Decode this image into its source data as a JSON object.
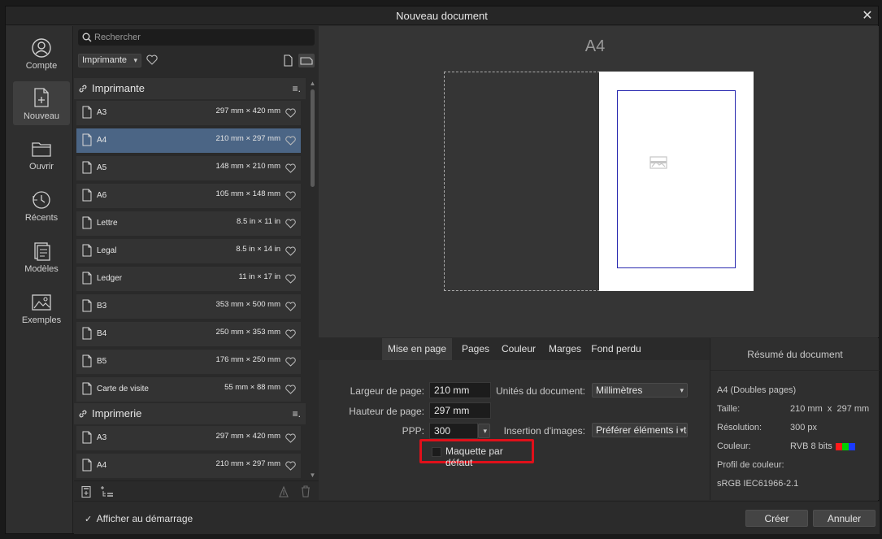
{
  "window": {
    "title": "Nouveau document",
    "close_glyph": "✕"
  },
  "nav": [
    {
      "label": "Compte",
      "icon": "account-icon"
    },
    {
      "label": "Nouveau",
      "icon": "new-document-icon",
      "active": true
    },
    {
      "label": "Ouvrir",
      "icon": "folder-icon"
    },
    {
      "label": "Récents",
      "icon": "recent-clock-icon"
    },
    {
      "label": "Modèles",
      "icon": "templates-icon"
    },
    {
      "label": "Exemples",
      "icon": "samples-image-icon"
    }
  ],
  "list": {
    "search_placeholder": "Rechercher",
    "filter_value": "Imprimante",
    "groups": [
      {
        "title": "Imprimante",
        "menu_glyph": "≡."
      },
      {
        "title": "Imprimerie",
        "menu_glyph": "≡."
      }
    ],
    "printer_rows": [
      {
        "name": "A3",
        "size": "297 mm × 420 mm"
      },
      {
        "name": "A4",
        "size": "210 mm × 297 mm",
        "selected": true
      },
      {
        "name": "A5",
        "size": "148 mm × 210 mm"
      },
      {
        "name": "A6",
        "size": "105 mm × 148 mm"
      },
      {
        "name": "Lettre",
        "size": "8.5 in × 11 in"
      },
      {
        "name": "Legal",
        "size": "8.5 in × 14 in"
      },
      {
        "name": "Ledger",
        "size": "11 in × 17 in"
      },
      {
        "name": "B3",
        "size": "353 mm × 500 mm"
      },
      {
        "name": "B4",
        "size": "250 mm × 353 mm"
      },
      {
        "name": "B5",
        "size": "176 mm × 250 mm"
      },
      {
        "name": "Carte de visite",
        "size": "55 mm × 88 mm"
      }
    ],
    "press_rows": [
      {
        "name": "A3",
        "size": "297 mm × 420 mm"
      },
      {
        "name": "A4",
        "size": "210 mm × 297 mm"
      }
    ]
  },
  "preview": {
    "title": "A4"
  },
  "tabs": [
    "Mise en page",
    "Pages",
    "Couleur",
    "Marges",
    "Fond perdu"
  ],
  "layout_form": {
    "width_label": "Largeur de page:",
    "width_value": "210 mm",
    "height_label": "Hauteur de page:",
    "height_value": "297 mm",
    "dpi_label": "PPP:",
    "dpi_value": "300",
    "units_label": "Unités du document:",
    "units_value": "Millimètres",
    "images_label": "Insertion d'images:",
    "images_value": "Préférer éléments intégrés",
    "default_master_label": "Maquette par défaut",
    "default_master_checked": false
  },
  "summary": {
    "title": "Résumé du document",
    "doc_type": "A4 (Doubles pages)",
    "size_label": "Taille:",
    "size_value": "210 mm  x  297 mm",
    "resolution_label": "Résolution:",
    "resolution_value": "300 px",
    "color_label": "Couleur:",
    "color_value": "RVB 8 bits",
    "swatches": [
      "#ff1a1a",
      "#00d000",
      "#1a3aff"
    ],
    "profile_label": "Profil de couleur:",
    "profile_value": "sRGB IEC61966-2.1"
  },
  "footer": {
    "show_at_startup_label": "Afficher au démarrage",
    "show_at_startup_checked": true,
    "create_label": "Créer",
    "cancel_label": "Annuler"
  }
}
